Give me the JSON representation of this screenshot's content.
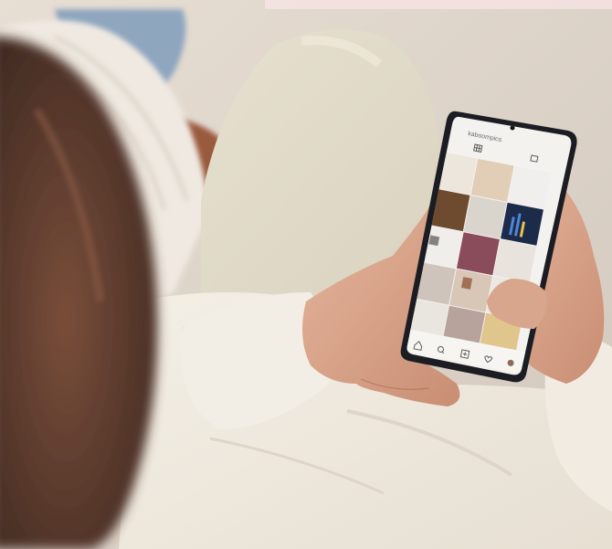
{
  "photo": {
    "subject": "person-holding-smartphone-browsing-photo-grid",
    "screen": {
      "profile_username": "kaboompics",
      "grid_icon": "grid-icon",
      "tag_icon": "tag-icon",
      "bottom_nav_icons": [
        "home-icon",
        "search-icon",
        "add-icon",
        "heart-icon",
        "profile-icon"
      ]
    },
    "colors": {
      "wall": "#dcd3c9",
      "sofa": "#e3dccb",
      "sweater": "#efe9df",
      "skin": "#d6a48c",
      "hair": "#5a3a2c",
      "phone_body": "#1c1e24",
      "screen_bg": "#f4f2ef"
    }
  }
}
